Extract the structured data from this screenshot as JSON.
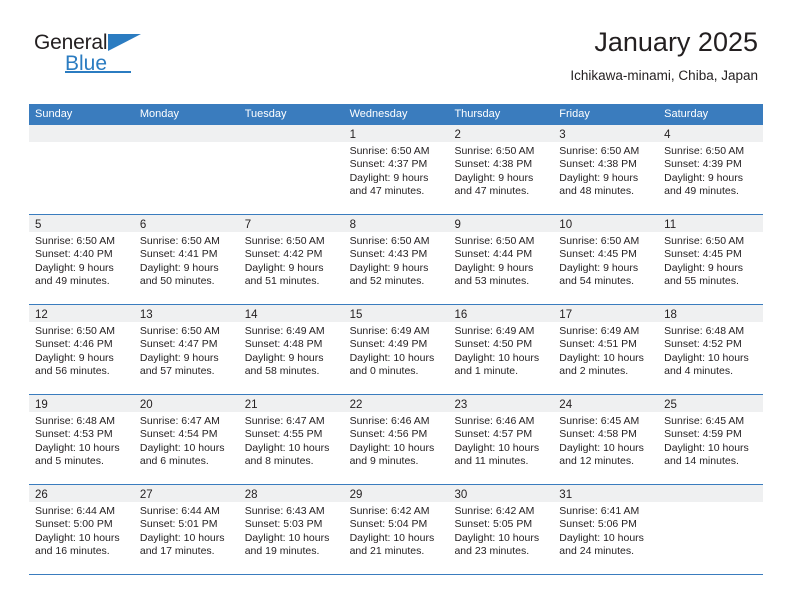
{
  "brand": {
    "name_part1": "General",
    "name_part2": "Blue",
    "accent_color": "#2b7cc1"
  },
  "header": {
    "title": "January 2025",
    "subtitle": "Ichikawa-minami, Chiba, Japan"
  },
  "calendar": {
    "header_color": "#3a7cbe",
    "weekdays": [
      "Sunday",
      "Monday",
      "Tuesday",
      "Wednesday",
      "Thursday",
      "Friday",
      "Saturday"
    ],
    "weeks": [
      [
        {
          "day": "",
          "empty": true
        },
        {
          "day": "",
          "empty": true
        },
        {
          "day": "",
          "empty": true
        },
        {
          "day": "1",
          "sunrise": "Sunrise: 6:50 AM",
          "sunset": "Sunset: 4:37 PM",
          "daylight1": "Daylight: 9 hours",
          "daylight2": "and 47 minutes."
        },
        {
          "day": "2",
          "sunrise": "Sunrise: 6:50 AM",
          "sunset": "Sunset: 4:38 PM",
          "daylight1": "Daylight: 9 hours",
          "daylight2": "and 47 minutes."
        },
        {
          "day": "3",
          "sunrise": "Sunrise: 6:50 AM",
          "sunset": "Sunset: 4:38 PM",
          "daylight1": "Daylight: 9 hours",
          "daylight2": "and 48 minutes."
        },
        {
          "day": "4",
          "sunrise": "Sunrise: 6:50 AM",
          "sunset": "Sunset: 4:39 PM",
          "daylight1": "Daylight: 9 hours",
          "daylight2": "and 49 minutes."
        }
      ],
      [
        {
          "day": "5",
          "sunrise": "Sunrise: 6:50 AM",
          "sunset": "Sunset: 4:40 PM",
          "daylight1": "Daylight: 9 hours",
          "daylight2": "and 49 minutes."
        },
        {
          "day": "6",
          "sunrise": "Sunrise: 6:50 AM",
          "sunset": "Sunset: 4:41 PM",
          "daylight1": "Daylight: 9 hours",
          "daylight2": "and 50 minutes."
        },
        {
          "day": "7",
          "sunrise": "Sunrise: 6:50 AM",
          "sunset": "Sunset: 4:42 PM",
          "daylight1": "Daylight: 9 hours",
          "daylight2": "and 51 minutes."
        },
        {
          "day": "8",
          "sunrise": "Sunrise: 6:50 AM",
          "sunset": "Sunset: 4:43 PM",
          "daylight1": "Daylight: 9 hours",
          "daylight2": "and 52 minutes."
        },
        {
          "day": "9",
          "sunrise": "Sunrise: 6:50 AM",
          "sunset": "Sunset: 4:44 PM",
          "daylight1": "Daylight: 9 hours",
          "daylight2": "and 53 minutes."
        },
        {
          "day": "10",
          "sunrise": "Sunrise: 6:50 AM",
          "sunset": "Sunset: 4:45 PM",
          "daylight1": "Daylight: 9 hours",
          "daylight2": "and 54 minutes."
        },
        {
          "day": "11",
          "sunrise": "Sunrise: 6:50 AM",
          "sunset": "Sunset: 4:45 PM",
          "daylight1": "Daylight: 9 hours",
          "daylight2": "and 55 minutes."
        }
      ],
      [
        {
          "day": "12",
          "sunrise": "Sunrise: 6:50 AM",
          "sunset": "Sunset: 4:46 PM",
          "daylight1": "Daylight: 9 hours",
          "daylight2": "and 56 minutes."
        },
        {
          "day": "13",
          "sunrise": "Sunrise: 6:50 AM",
          "sunset": "Sunset: 4:47 PM",
          "daylight1": "Daylight: 9 hours",
          "daylight2": "and 57 minutes."
        },
        {
          "day": "14",
          "sunrise": "Sunrise: 6:49 AM",
          "sunset": "Sunset: 4:48 PM",
          "daylight1": "Daylight: 9 hours",
          "daylight2": "and 58 minutes."
        },
        {
          "day": "15",
          "sunrise": "Sunrise: 6:49 AM",
          "sunset": "Sunset: 4:49 PM",
          "daylight1": "Daylight: 10 hours",
          "daylight2": "and 0 minutes."
        },
        {
          "day": "16",
          "sunrise": "Sunrise: 6:49 AM",
          "sunset": "Sunset: 4:50 PM",
          "daylight1": "Daylight: 10 hours",
          "daylight2": "and 1 minute."
        },
        {
          "day": "17",
          "sunrise": "Sunrise: 6:49 AM",
          "sunset": "Sunset: 4:51 PM",
          "daylight1": "Daylight: 10 hours",
          "daylight2": "and 2 minutes."
        },
        {
          "day": "18",
          "sunrise": "Sunrise: 6:48 AM",
          "sunset": "Sunset: 4:52 PM",
          "daylight1": "Daylight: 10 hours",
          "daylight2": "and 4 minutes."
        }
      ],
      [
        {
          "day": "19",
          "sunrise": "Sunrise: 6:48 AM",
          "sunset": "Sunset: 4:53 PM",
          "daylight1": "Daylight: 10 hours",
          "daylight2": "and 5 minutes."
        },
        {
          "day": "20",
          "sunrise": "Sunrise: 6:47 AM",
          "sunset": "Sunset: 4:54 PM",
          "daylight1": "Daylight: 10 hours",
          "daylight2": "and 6 minutes."
        },
        {
          "day": "21",
          "sunrise": "Sunrise: 6:47 AM",
          "sunset": "Sunset: 4:55 PM",
          "daylight1": "Daylight: 10 hours",
          "daylight2": "and 8 minutes."
        },
        {
          "day": "22",
          "sunrise": "Sunrise: 6:46 AM",
          "sunset": "Sunset: 4:56 PM",
          "daylight1": "Daylight: 10 hours",
          "daylight2": "and 9 minutes."
        },
        {
          "day": "23",
          "sunrise": "Sunrise: 6:46 AM",
          "sunset": "Sunset: 4:57 PM",
          "daylight1": "Daylight: 10 hours",
          "daylight2": "and 11 minutes."
        },
        {
          "day": "24",
          "sunrise": "Sunrise: 6:45 AM",
          "sunset": "Sunset: 4:58 PM",
          "daylight1": "Daylight: 10 hours",
          "daylight2": "and 12 minutes."
        },
        {
          "day": "25",
          "sunrise": "Sunrise: 6:45 AM",
          "sunset": "Sunset: 4:59 PM",
          "daylight1": "Daylight: 10 hours",
          "daylight2": "and 14 minutes."
        }
      ],
      [
        {
          "day": "26",
          "sunrise": "Sunrise: 6:44 AM",
          "sunset": "Sunset: 5:00 PM",
          "daylight1": "Daylight: 10 hours",
          "daylight2": "and 16 minutes."
        },
        {
          "day": "27",
          "sunrise": "Sunrise: 6:44 AM",
          "sunset": "Sunset: 5:01 PM",
          "daylight1": "Daylight: 10 hours",
          "daylight2": "and 17 minutes."
        },
        {
          "day": "28",
          "sunrise": "Sunrise: 6:43 AM",
          "sunset": "Sunset: 5:03 PM",
          "daylight1": "Daylight: 10 hours",
          "daylight2": "and 19 minutes."
        },
        {
          "day": "29",
          "sunrise": "Sunrise: 6:42 AM",
          "sunset": "Sunset: 5:04 PM",
          "daylight1": "Daylight: 10 hours",
          "daylight2": "and 21 minutes."
        },
        {
          "day": "30",
          "sunrise": "Sunrise: 6:42 AM",
          "sunset": "Sunset: 5:05 PM",
          "daylight1": "Daylight: 10 hours",
          "daylight2": "and 23 minutes."
        },
        {
          "day": "31",
          "sunrise": "Sunrise: 6:41 AM",
          "sunset": "Sunset: 5:06 PM",
          "daylight1": "Daylight: 10 hours",
          "daylight2": "and 24 minutes."
        },
        {
          "day": "",
          "empty": true
        }
      ]
    ]
  }
}
